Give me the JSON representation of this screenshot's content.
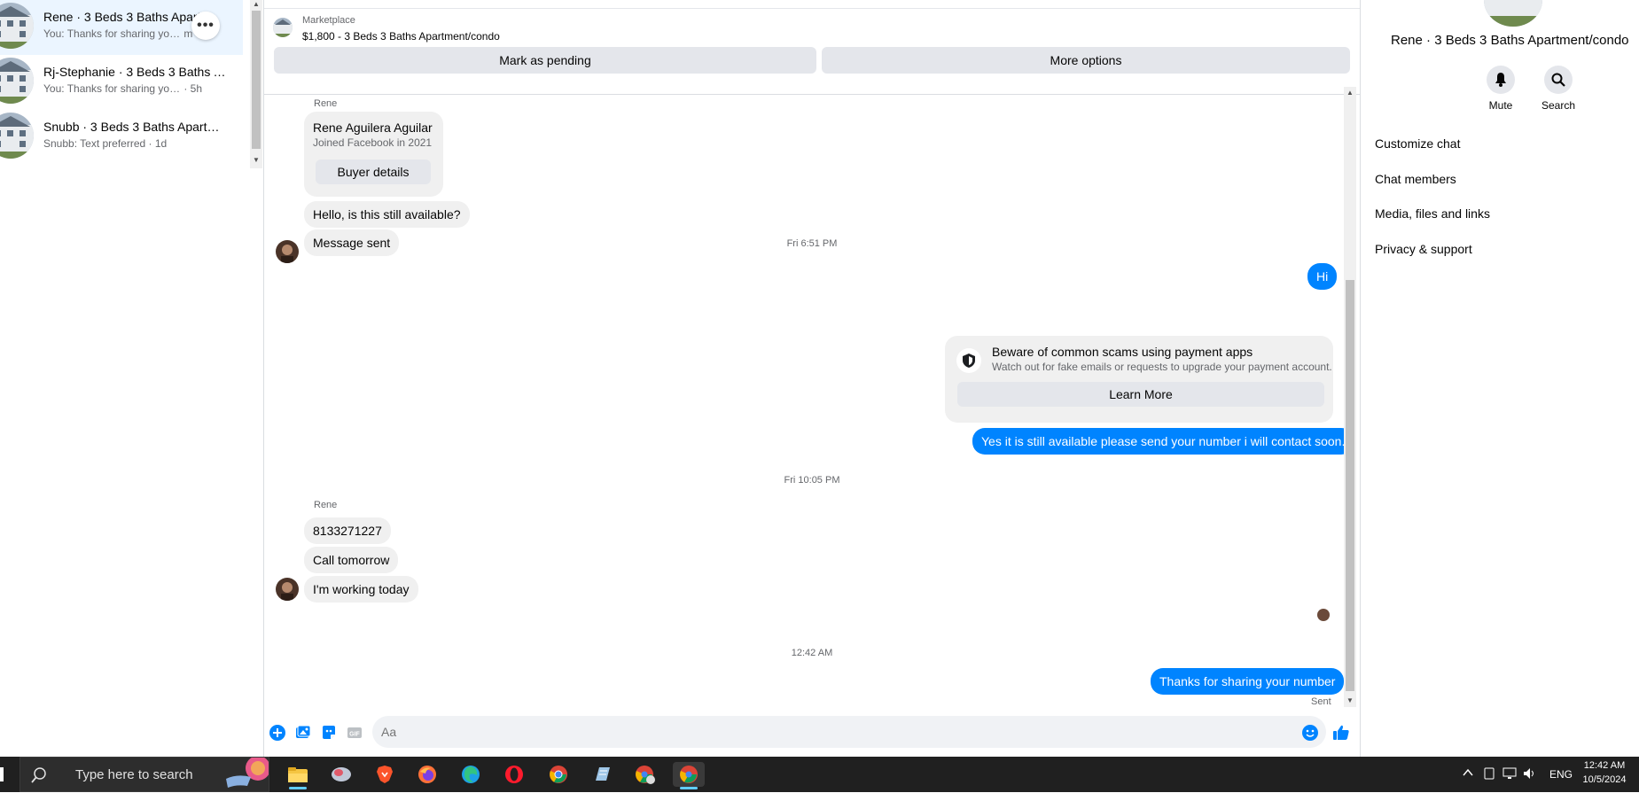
{
  "sidebar": {
    "conversations": [
      {
        "title": "Rene · 3 Beds 3 Baths Apart…",
        "preview": "You: Thanks for sharing your num…",
        "time": "m"
      },
      {
        "title": "Rj-Stephanie · 3 Beds 3 Baths A…",
        "preview": "You: Thanks for sharing your num…",
        "time": "· 5h"
      },
      {
        "title": "Snubb · 3 Beds 3 Baths Apartm…",
        "preview": "Snubb: Text preferred",
        "time": "· 1d"
      }
    ],
    "more_label": "•••"
  },
  "header": {
    "marketplace_label": "Marketplace",
    "listing_title": "$1,800 - 3 Beds 3 Baths Apartment/condo",
    "mark_pending_label": "Mark as pending",
    "more_options_label": "More options"
  },
  "messages": {
    "sender_name_1": "Rene",
    "card": {
      "name": "Rene Aguilera Aguilar",
      "joined": "Joined Facebook in 2021",
      "button": "Buyer details"
    },
    "in_1": "Hello, is this still available?",
    "in_2": "Message sent",
    "ts_1": "Fri 6:51 PM",
    "out_1": "Hi",
    "scam": {
      "title": "Beware of common scams using payment apps",
      "subtitle": "Watch out for fake emails or requests to upgrade your payment account.",
      "button": "Learn More"
    },
    "out_2": "Yes it is still available please send your number i will contact soon.",
    "ts_2": "Fri 10:05 PM",
    "sender_name_2": "Rene",
    "in_3": "8133271227",
    "in_4": "Call tomorrow",
    "in_5": "I'm working today",
    "ts_3": "12:42 AM",
    "out_3": "Thanks for sharing your number",
    "sent_label": "Sent"
  },
  "composer": {
    "placeholder": "Aa",
    "gif_label": "GIF"
  },
  "right_panel": {
    "title": "Rene · 3 Beds 3 Baths Apartment/condo",
    "mute_label": "Mute",
    "search_label": "Search",
    "menu": [
      "Customize chat",
      "Chat members",
      "Media, files and links",
      "Privacy & support"
    ]
  },
  "taskbar": {
    "search_placeholder": "Type here to search",
    "tray_lang": "ENG",
    "time": "12:42 AM",
    "date": "10/5/2024"
  },
  "colors": {
    "accent": "#0084ff",
    "bubble_in": "#f0f0f0",
    "taskbar": "#202020"
  }
}
